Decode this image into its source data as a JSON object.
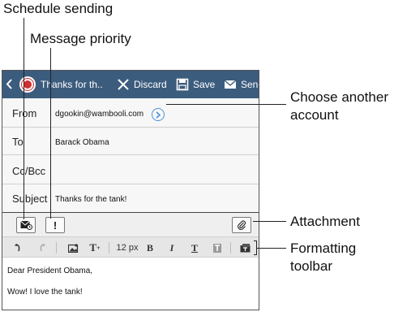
{
  "callouts": {
    "schedule_sending": "Schedule sending",
    "message_priority": "Message priority",
    "choose_account_line1": "Choose another",
    "choose_account_line2": "account",
    "attachment": "Attachment",
    "formatting_line1": "Formatting",
    "formatting_line2": "toolbar"
  },
  "actionbar": {
    "title": "Thanks for th..",
    "discard_label": "Discard",
    "save_label": "Save",
    "send_label": "Send",
    "icons": [
      "back-chevron-icon",
      "app-logo-icon",
      "close-x-icon",
      "save-disk-icon",
      "send-envelope-icon"
    ]
  },
  "fields": {
    "from_label": "From",
    "from_value": "dgookin@wambooli.com",
    "to_label": "To",
    "to_value": "Barack Obama",
    "ccbcc_label": "Cc/Bcc",
    "ccbcc_value": "",
    "subject_label": "Subject",
    "subject_value": "Thanks for the tank!"
  },
  "options": {
    "priority_symbol": "!",
    "icons": [
      "schedule-send-icon",
      "priority-icon",
      "paperclip-icon"
    ]
  },
  "formatting": {
    "font_size": "12 px",
    "bold": "B",
    "italic": "I",
    "underline": "T",
    "tplus": "T",
    "icons": [
      "undo-icon",
      "redo-icon",
      "insert-image-icon",
      "font-increase-icon",
      "bold-icon",
      "italic-icon",
      "underline-icon",
      "text-color-icon",
      "more-icon"
    ]
  },
  "body": {
    "line1": "Dear President Obama,",
    "line2": "Wow! I love the tank!"
  },
  "colors": {
    "actionbar": "#3c5c7e",
    "accent_chevron": "#4a90d9",
    "logo_red": "#d32f2f"
  }
}
